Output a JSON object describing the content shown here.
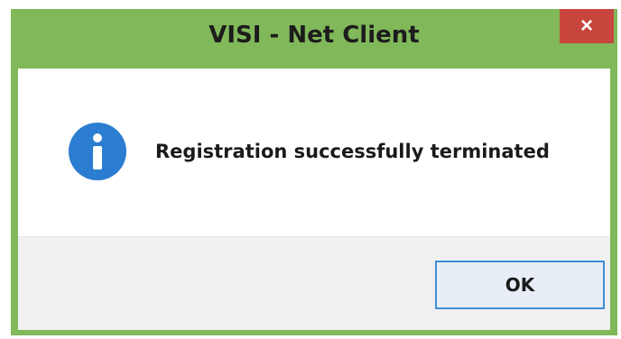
{
  "dialog": {
    "title": "VISI - Net Client",
    "close_glyph": "×",
    "message": "Registration successfully terminated",
    "icon": "info-icon",
    "ok_label": "OK"
  },
  "colors": {
    "frame": "#80b85a",
    "close": "#c7453c",
    "info_icon": "#2a7dd0",
    "button_border": "#3c8ed8"
  }
}
